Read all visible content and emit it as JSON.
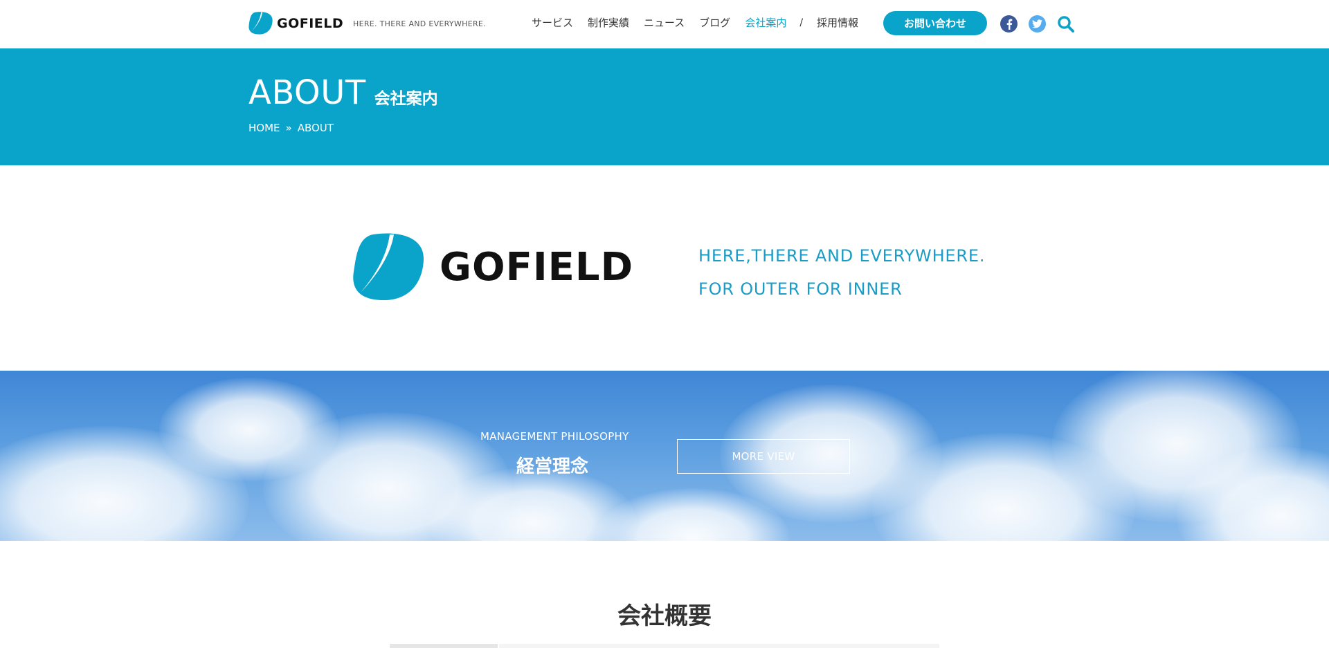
{
  "header": {
    "logo_text": "GOFIELD",
    "tagline": "HERE. THERE AND EVERYWHERE.",
    "nav": [
      {
        "label": "サービス"
      },
      {
        "label": "制作実績"
      },
      {
        "label": "ニュース"
      },
      {
        "label": "ブログ"
      },
      {
        "label": "会社案内",
        "active": true
      }
    ],
    "nav_separator": "/",
    "nav_recruit": "採用情報",
    "contact_label": "お問い合わせ",
    "facebook_icon": "facebook-icon",
    "twitter_icon": "twitter-icon",
    "search_icon": "search-icon"
  },
  "page_header": {
    "title_en": "ABOUT",
    "title_ja": "会社案内",
    "breadcrumb": [
      "HOME",
      "»",
      "ABOUT"
    ]
  },
  "intro": {
    "logo_text": "GOFIELD",
    "motto_line1": "HERE,THERE AND EVERYWHERE.",
    "motto_line2": "FOR OUTER FOR INNER"
  },
  "philosophy": {
    "label_en": "MANAGEMENT PHILOSOPHY",
    "title_ja": "経営理念",
    "button_label": "MORE VIEW"
  },
  "overview": {
    "title": "会社概要"
  },
  "colors": {
    "brand": "#0aa3c9",
    "motto": "#1a9cc7",
    "facebook": "#3b5998",
    "twitter": "#55acee"
  }
}
